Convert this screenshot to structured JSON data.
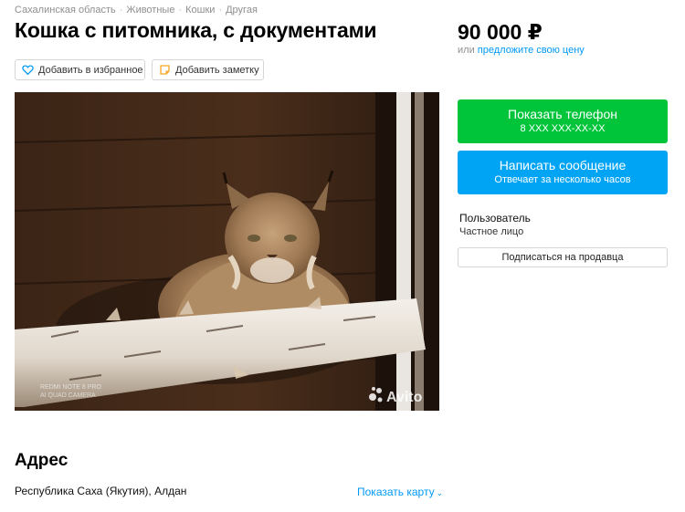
{
  "breadcrumb": [
    "Сахалинская область",
    "Животные",
    "Кошки",
    "Другая"
  ],
  "title": "Кошка с питомника, с документами",
  "actions": {
    "favorite": "Добавить в избранное",
    "note": "Добавить заметку"
  },
  "photo": {
    "watermark": "Avito",
    "camera_text": "REDMI NOTE 8 PRO\nAI QUAD CAMERA",
    "icons": {
      "favorite": "heart-icon",
      "note": "note-icon"
    }
  },
  "price": {
    "value": "90 000 ₽",
    "offer_prefix": "или",
    "offer_link": "предложите свою цену"
  },
  "contact": {
    "phone_label": "Показать телефон",
    "phone_number": "8 XXX XXX-XX-XX",
    "message_label": "Написать сообщение",
    "message_sub": "Отвечает за несколько часов",
    "colors": {
      "phone": "#00c53b",
      "message": "#00a4f5",
      "link": "#0099f7"
    }
  },
  "seller": {
    "name": "Пользователь",
    "type": "Частное лицо",
    "subscribe": "Подписаться на продавца"
  },
  "address": {
    "heading": "Адрес",
    "text": "Республика Саха (Якутия), Алдан",
    "map_link": "Показать карту"
  }
}
